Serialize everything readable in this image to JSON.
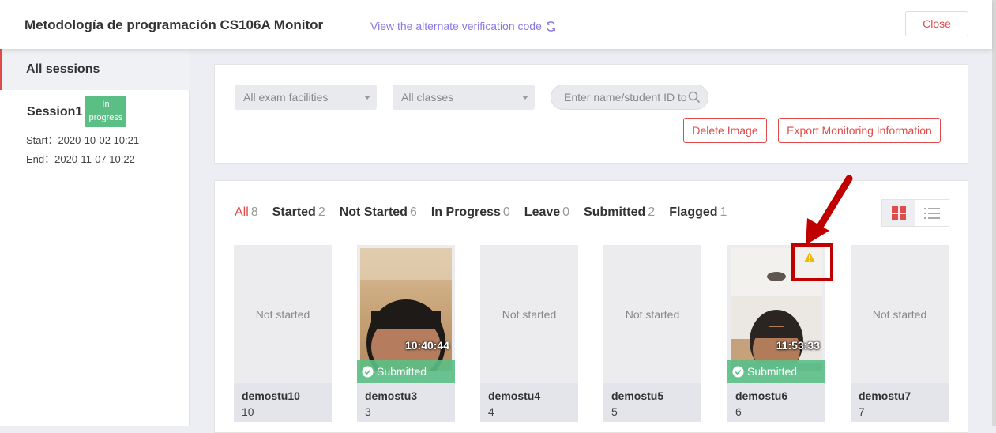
{
  "header": {
    "title": "Metodología de programación CS106A  Monitor",
    "alt_link": "View the alternate verification code",
    "close_label": "Close"
  },
  "sidebar": {
    "all_sessions": "All sessions",
    "session": {
      "name": "Session1",
      "badge": "In progress",
      "start": "Start：2020-10-02 10:21",
      "end": "End：2020-11-07 10:22"
    }
  },
  "filters": {
    "facility_select": "All exam facilities",
    "class_select": "All classes",
    "search_placeholder": "Enter name/student ID to",
    "delete_image_label": "Delete Image",
    "export_label": "Export Monitoring Information"
  },
  "tabs": [
    {
      "label": "All",
      "count": "8"
    },
    {
      "label": "Started",
      "count": "2"
    },
    {
      "label": "Not Started",
      "count": "6"
    },
    {
      "label": "In Progress",
      "count": "0"
    },
    {
      "label": "Leave",
      "count": "0"
    },
    {
      "label": "Submitted",
      "count": "2"
    },
    {
      "label": "Flagged",
      "count": "1"
    }
  ],
  "cards": [
    {
      "name": "demostu10",
      "id": "10",
      "status_text": "Not started"
    },
    {
      "name": "demostu3",
      "id": "3",
      "timestamp": "10:40:44",
      "status_text": "Submitted"
    },
    {
      "name": "demostu4",
      "id": "4",
      "status_text": "Not started"
    },
    {
      "name": "demostu5",
      "id": "5",
      "status_text": "Not started"
    },
    {
      "name": "demostu6",
      "id": "6",
      "timestamp": "11:53:33",
      "status_text": "Submitted"
    },
    {
      "name": "demostu7",
      "id": "7",
      "status_text": "Not started"
    }
  ],
  "colors": {
    "accent_red": "#e04b4b",
    "success_green": "#5bbf85",
    "link_purple": "#8a79e0",
    "warning_yellow": "#f5b800",
    "annotation_red": "#c00000"
  },
  "icons": [
    "refresh-icon",
    "search-icon",
    "grid-view-icon",
    "list-view-icon",
    "check-circle-icon",
    "warning-icon",
    "annotation-arrow"
  ]
}
